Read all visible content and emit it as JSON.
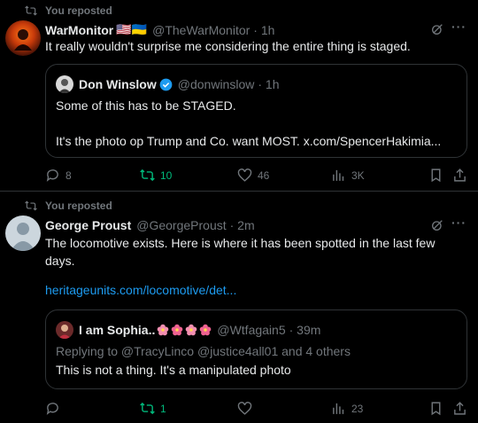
{
  "posts": [
    {
      "repost_label": "You reposted",
      "name": "WarMonitor",
      "flags": "🇺🇸🇺🇦",
      "handle": "@TheWarMonitor",
      "time": "· 1h",
      "text": "It really wouldn't surprise me considering the entire thing is staged.",
      "quote": {
        "name": "Don Winslow",
        "handle": "@donwinslow",
        "time": "· 1h",
        "line1": "Some of this has to be STAGED.",
        "line2": "It's the photo op Trump and Co. want MOST. x.com/SpencerHakimia..."
      },
      "actions": {
        "replies": "8",
        "reposts": "10",
        "likes": "46",
        "views": "3K"
      }
    },
    {
      "repost_label": "You reposted",
      "name": "George Proust",
      "handle": "@GeorgeProust",
      "time": "· 2m",
      "text": "The locomotive exists.  Here is where it has been spotted in the last few days.",
      "link": "heritageunits.com/locomotive/det...",
      "quote": {
        "name": "I am Sophia..",
        "handle": "@Wtfagain5",
        "time": "· 39m",
        "reply_line": "Replying to @TracyLinco @justice4all01 and 4 others",
        "line1": "This is not a thing.  It's a manipulated photo"
      },
      "actions": {
        "replies": "",
        "reposts": "1",
        "likes": "",
        "views": "23"
      }
    }
  ],
  "colors": {
    "accent": "#1d9bf0",
    "repost_green": "#00ba7c",
    "muted": "#71767b",
    "border": "#2f3336"
  }
}
